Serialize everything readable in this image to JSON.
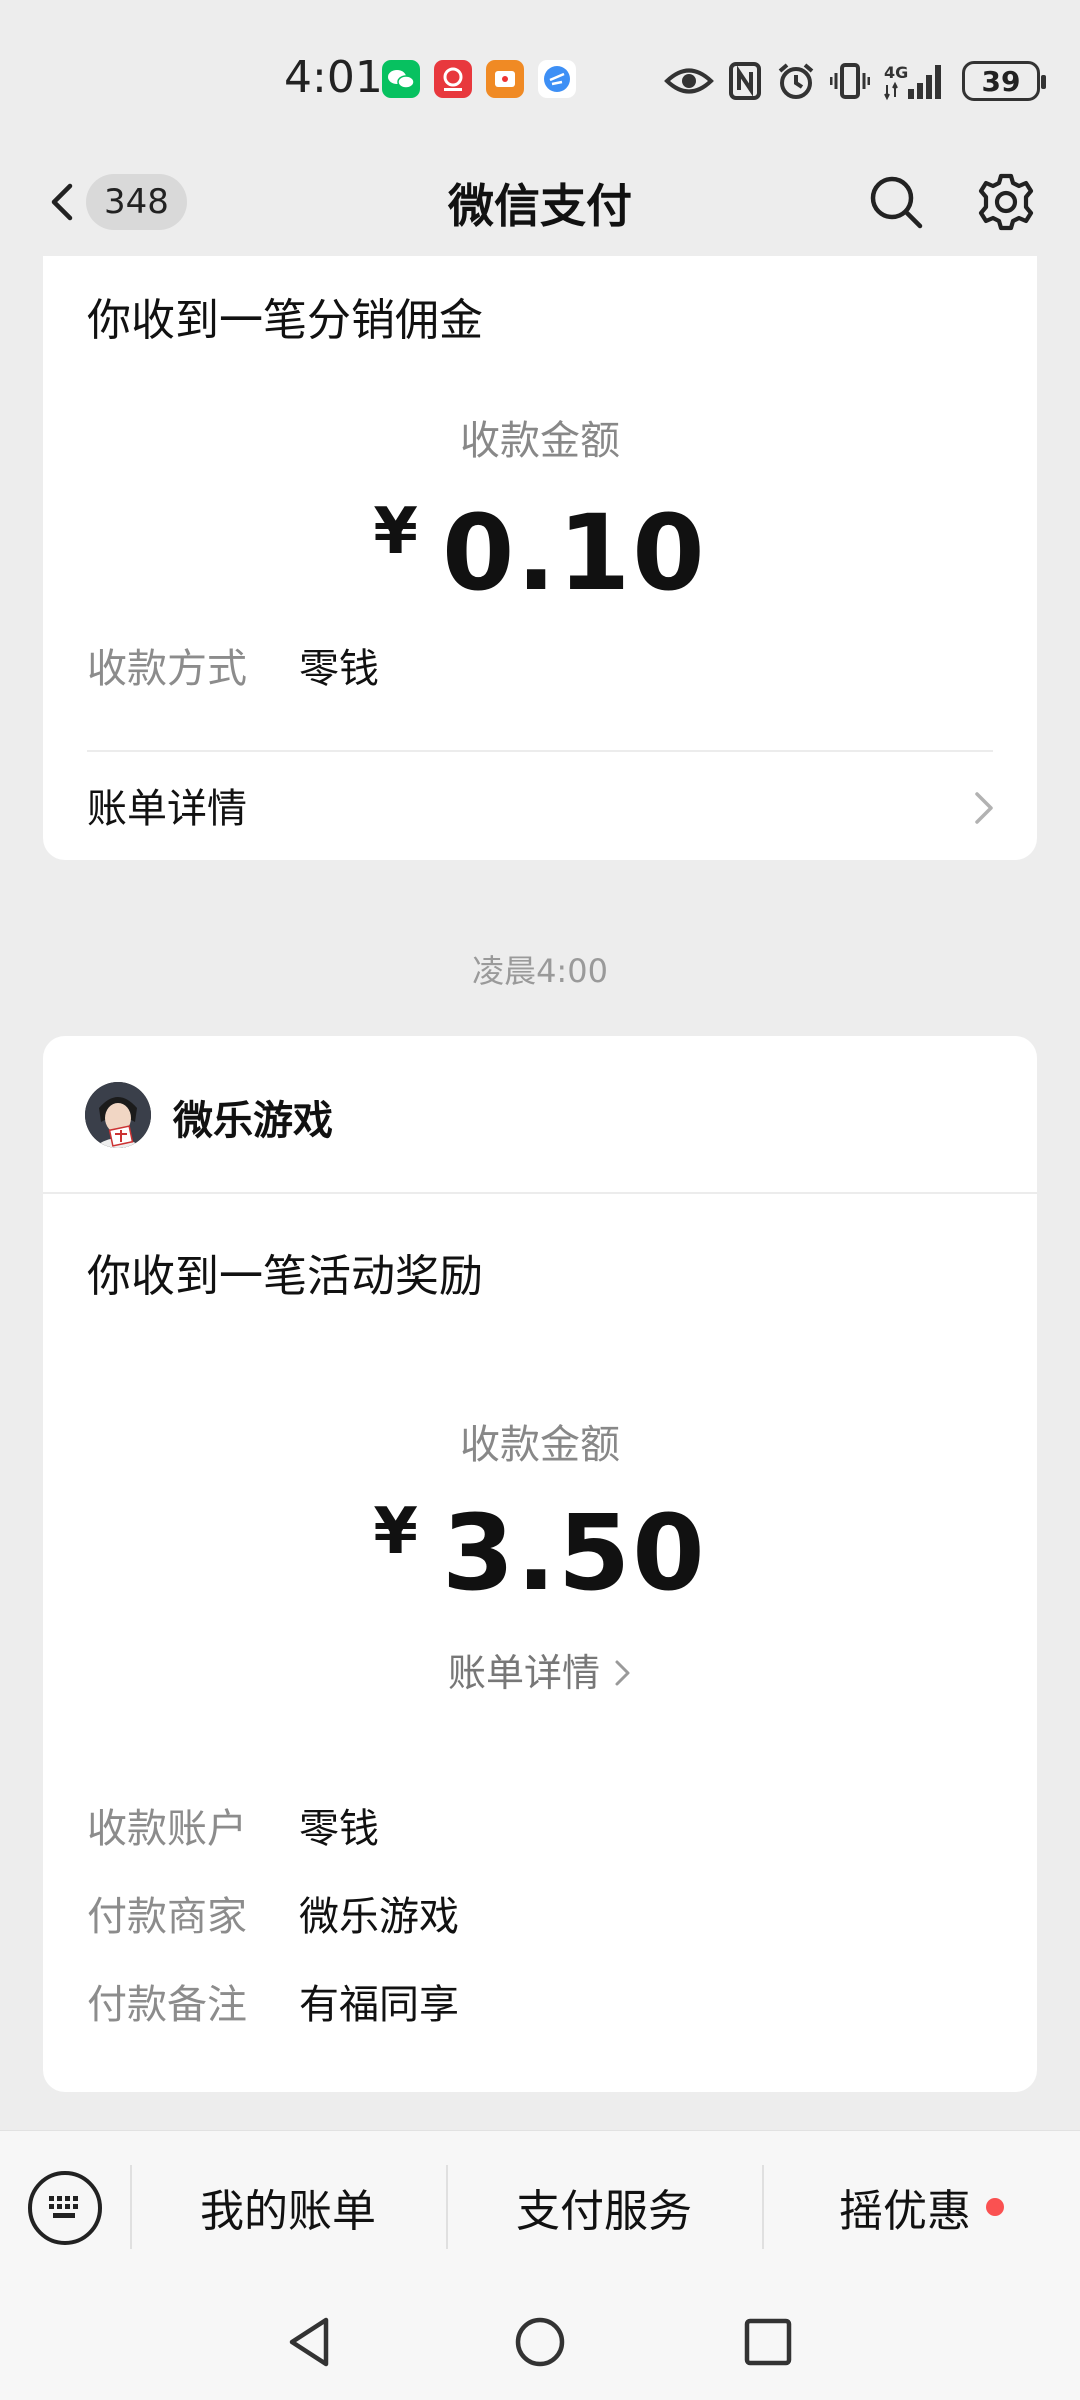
{
  "status_bar": {
    "time": "4:01",
    "battery": "39",
    "network": "4G"
  },
  "nav": {
    "unread_count": "348",
    "title": "微信支付"
  },
  "card1": {
    "title": "你收到一笔分销佣金",
    "amount_label": "收款金额",
    "currency": "¥",
    "amount": "0.10",
    "method_label": "收款方式",
    "method_value": "零钱",
    "bill_detail": "账单详情"
  },
  "timestamp": "凌晨4:00",
  "card2": {
    "merchant": "微乐游戏",
    "title": "你收到一笔活动奖励",
    "amount_label": "收款金额",
    "currency": "¥",
    "amount": "3.50",
    "bill_detail": "账单详情",
    "rows": [
      {
        "label": "收款账户",
        "value": "零钱"
      },
      {
        "label": "付款商家",
        "value": "微乐游戏"
      },
      {
        "label": "付款备注",
        "value": "有福同享"
      }
    ]
  },
  "bottom_menu": {
    "items": [
      "我的账单",
      "支付服务",
      "摇优惠"
    ]
  },
  "colors": {
    "background": "#ededed",
    "card": "#ffffff",
    "red_dot": "#fa5151"
  },
  "icons": [
    "back-icon",
    "search-icon",
    "gear-icon",
    "chevron-right-icon",
    "keyboard-icon",
    "nav-back-icon",
    "nav-home-icon",
    "nav-recents-icon"
  ]
}
